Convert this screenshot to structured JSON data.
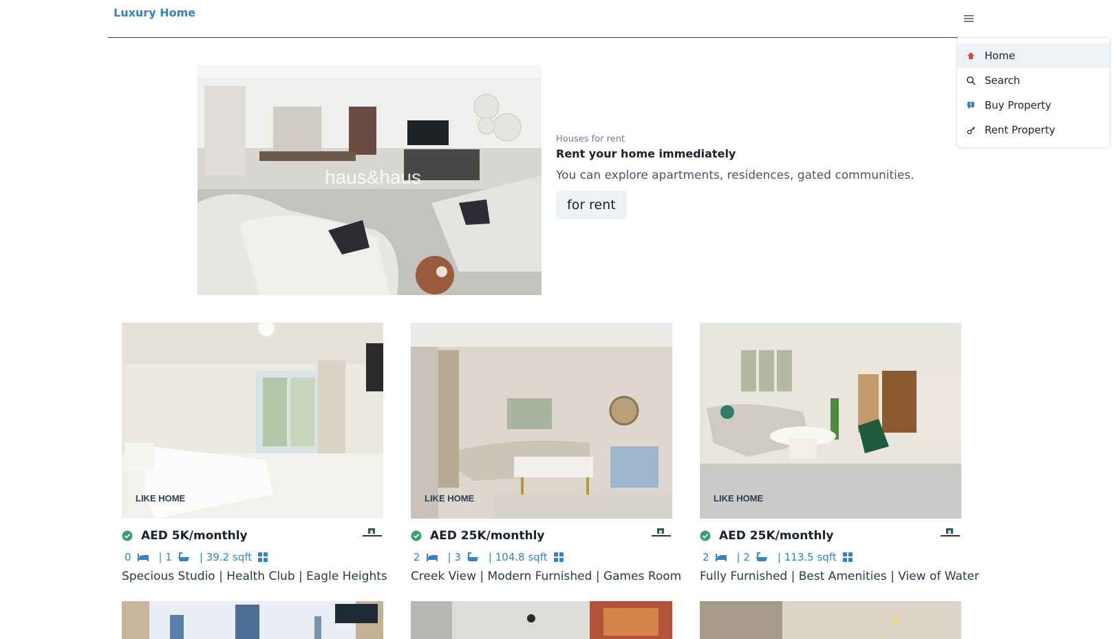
{
  "navbar": {
    "brand": "Luxury Home",
    "menu_icon": "hamburger-icon"
  },
  "dropdown": {
    "items": [
      {
        "label": "Home",
        "icon": "home-icon",
        "icon_color": "#e53e3e"
      },
      {
        "label": "Search",
        "icon": "search-icon",
        "icon_color": "#1a202c"
      },
      {
        "label": "Buy Property",
        "icon": "flag-icon",
        "icon_color": "#3182ce"
      },
      {
        "label": "Rent Property",
        "icon": "key-icon",
        "icon_color": "#1a202c"
      }
    ]
  },
  "hero": {
    "subtitle": "Houses for rent",
    "title": "Rent your home immediately",
    "description": "You can explore apartments, residences, gated communities.",
    "button_label": "for rent",
    "image_watermark": "haus&haus"
  },
  "colors": {
    "brand": "#3182ce",
    "verified": "#38a169",
    "accent": "#3182ce"
  },
  "cards": [
    {
      "price": "AED 5K/monthly",
      "rooms": "0",
      "baths": "| 1",
      "area": "| 39.2 sqft",
      "title": "Specious Studio | Health Club | Eagle Heights",
      "image_watermark": "LIKE HOME"
    },
    {
      "price": "AED 25K/monthly",
      "rooms": "2",
      "baths": "| 3",
      "area": "| 104.8 sqft",
      "title": "Creek View | Modern Furnished | Games Room",
      "image_watermark": "LIKE HOME"
    },
    {
      "price": "AED 25K/monthly",
      "rooms": "2",
      "baths": "| 2",
      "area": "| 113.5 sqft",
      "title": "Fully Furnished | Best Amenities | View of Water",
      "image_watermark": "LIKE HOME"
    }
  ]
}
